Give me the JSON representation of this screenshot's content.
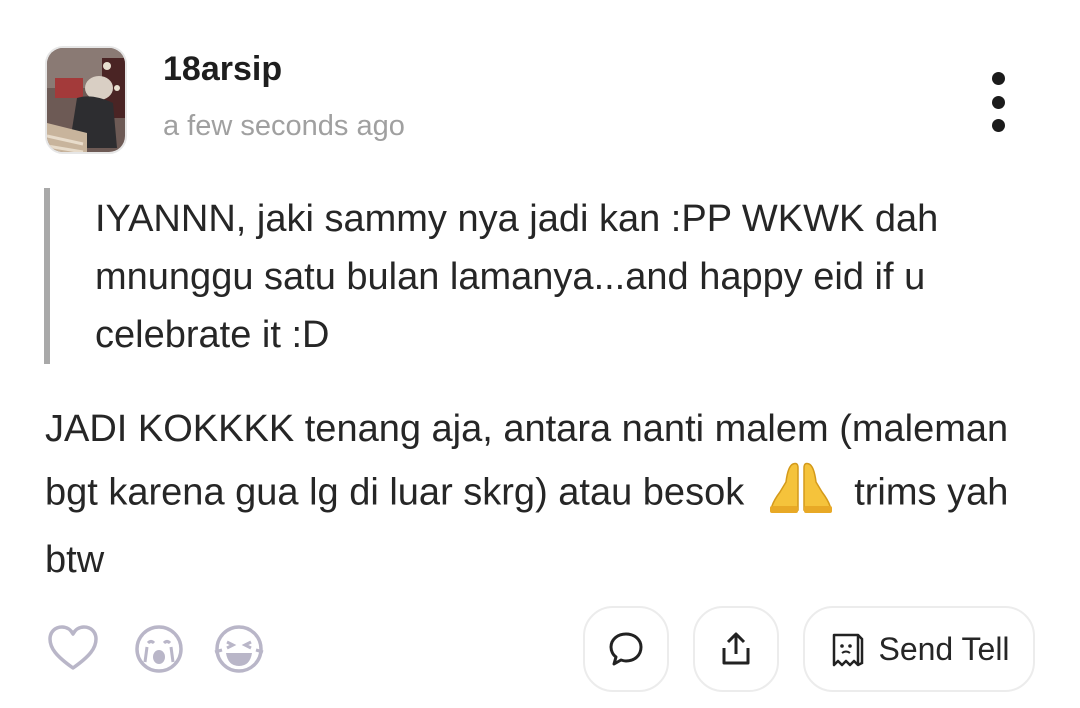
{
  "post": {
    "username": "18arsip",
    "timestamp": "a few seconds ago",
    "quote_text": "IYANNN, jaki sammy nya jadi kan :PP WKWK dah mnunggu satu bulan lamanya...and happy eid if u celebrate it :D",
    "reply_text_before_emoji": "JADI KOKKKK tenang aja, antara nanti malem (maleman bgt karena gua lg di luar skrg) atau besok",
    "reply_text_after_emoji": "trims yah btw"
  },
  "actions": {
    "send_tell_label": "Send Tell"
  },
  "icons": [
    "heart-icon",
    "crying-face-icon",
    "laughing-face-icon",
    "comment-icon",
    "share-icon",
    "send-tell-icon",
    "more-options-icon",
    "folded-hands-emoji"
  ],
  "colors": {
    "text": "#262626",
    "muted": "#a0a0a0",
    "icon_outline": "#b9b6c8",
    "quote_bar": "#a9a9a9"
  }
}
